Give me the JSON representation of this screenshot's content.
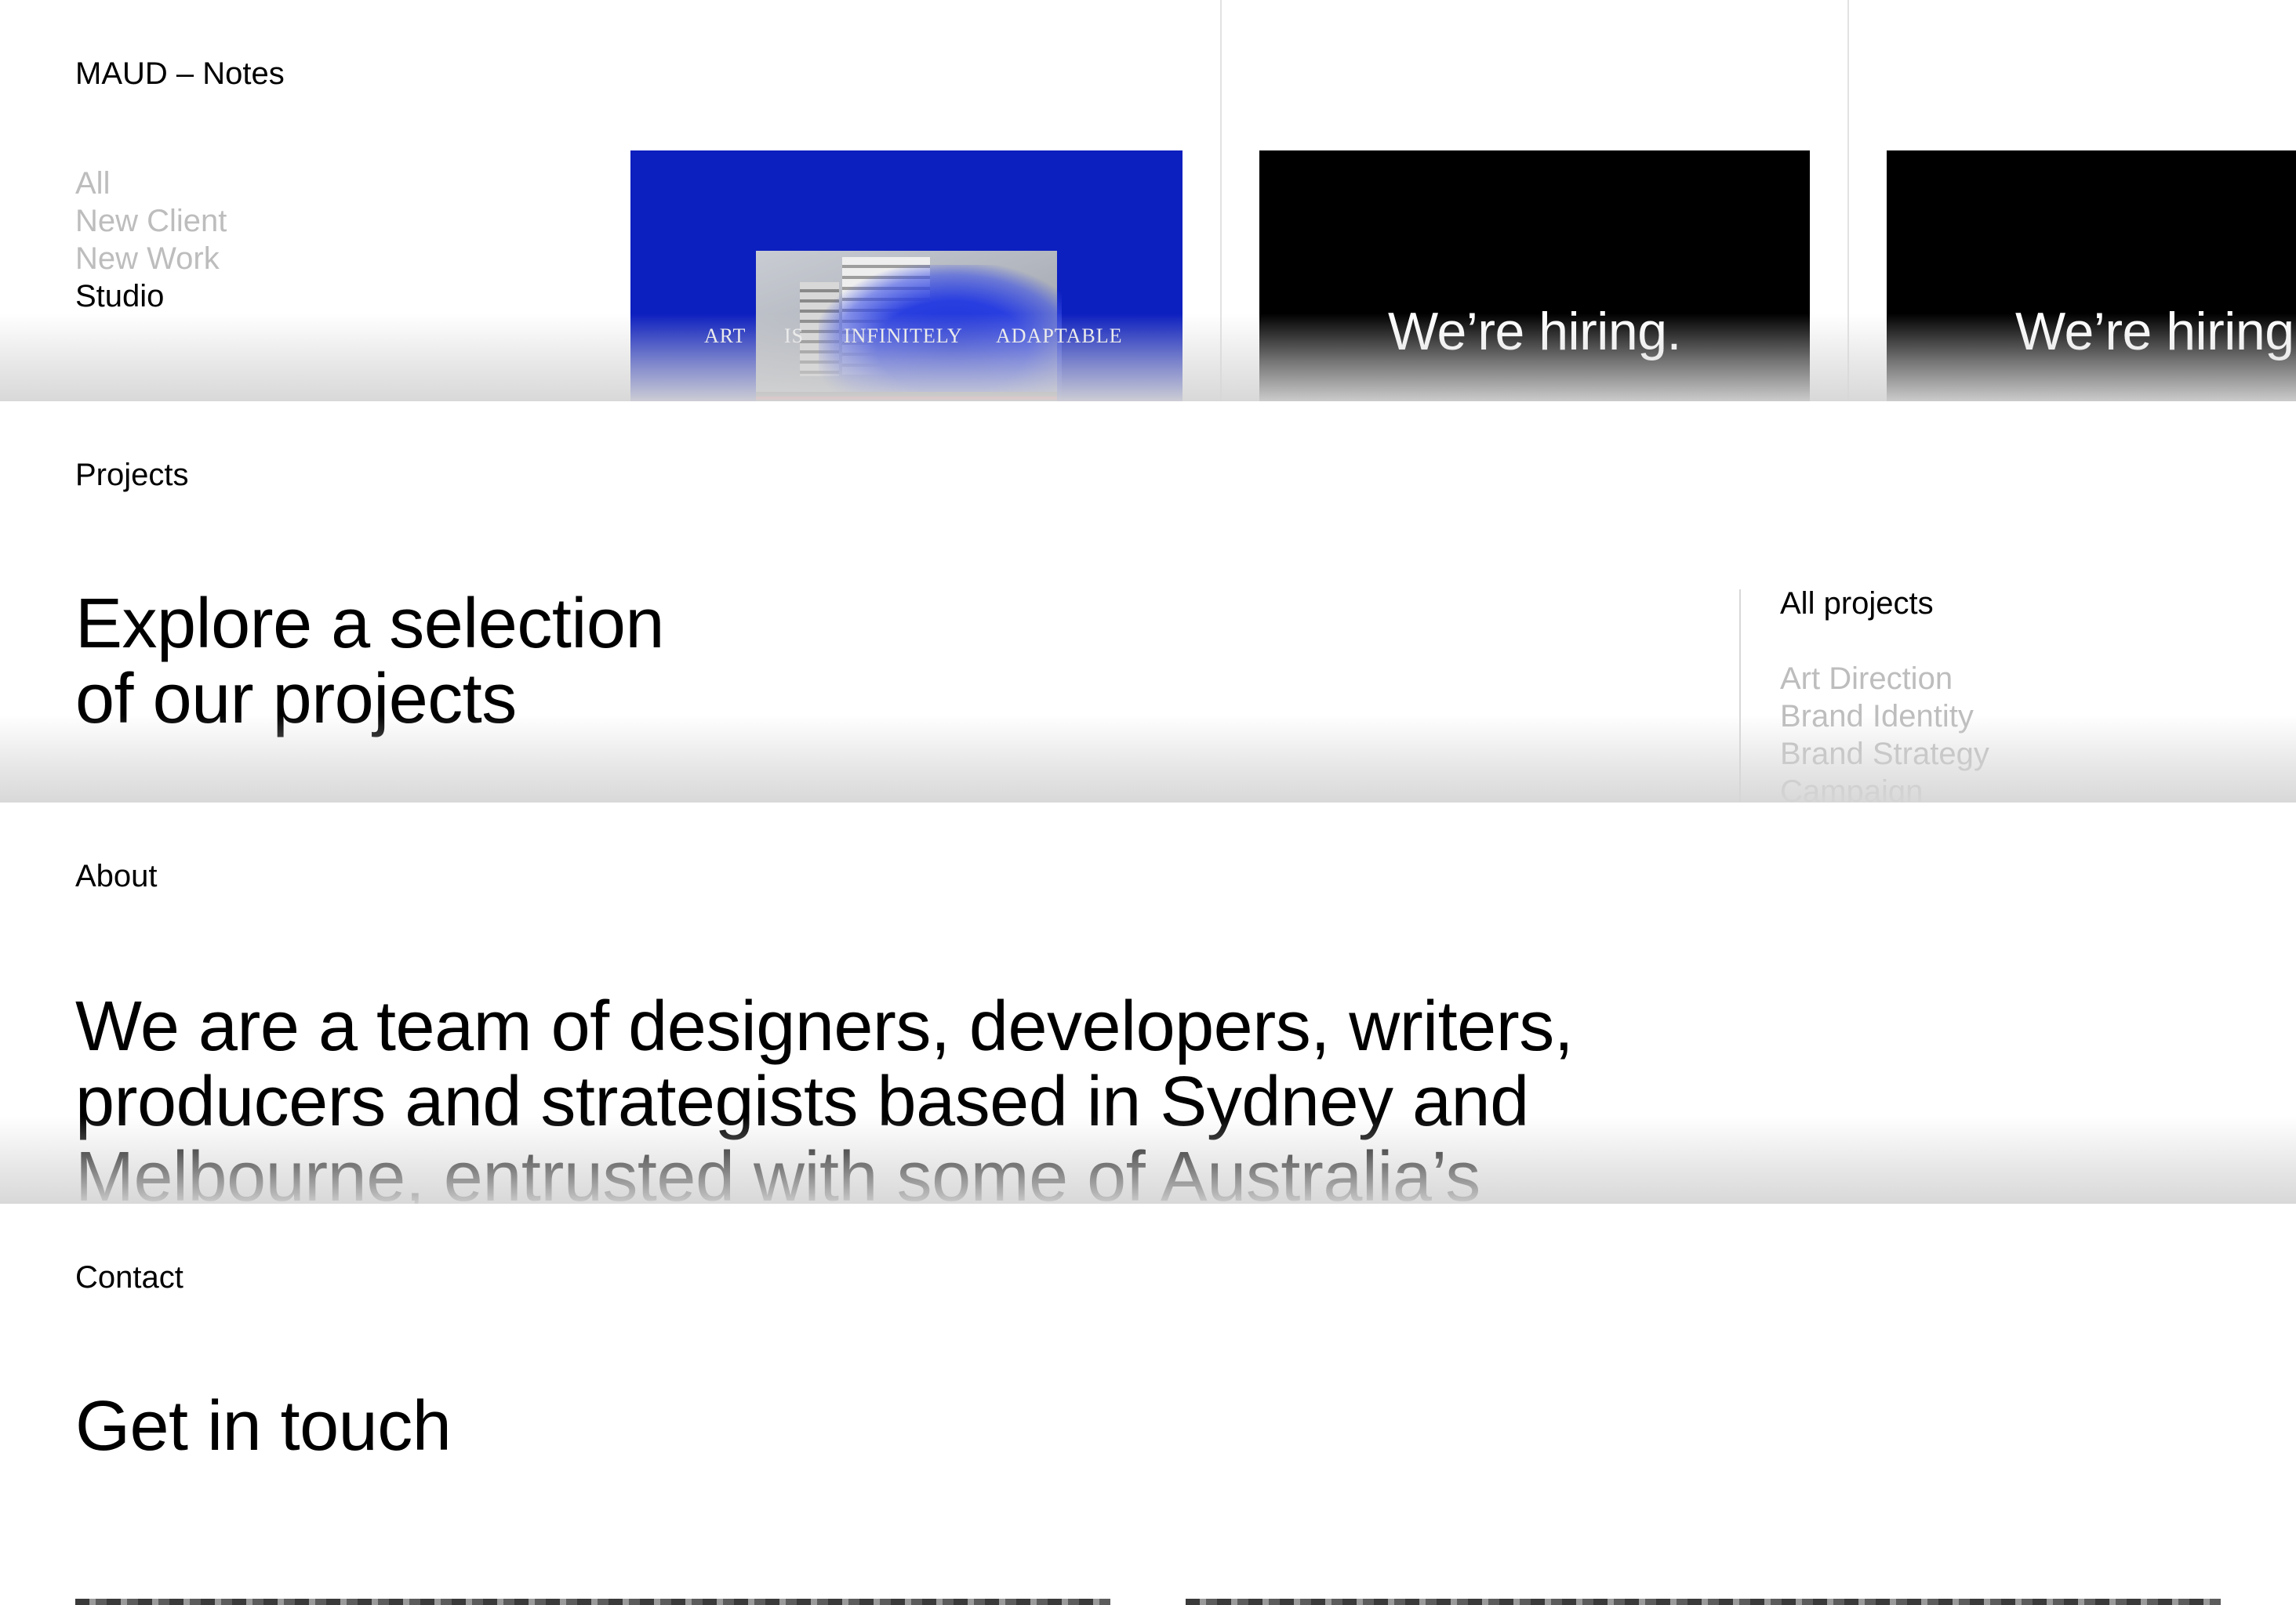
{
  "notes": {
    "title": "MAUD – Notes",
    "filters": [
      "All",
      "New Client",
      "New Work",
      "Studio"
    ],
    "active_filter": "Studio",
    "cards": [
      {
        "type": "image",
        "caption_words": [
          "ART",
          "IS",
          "INFINITELY",
          "ADAPTABLE"
        ],
        "bg": "#0c1fbf"
      },
      {
        "type": "text",
        "text": "We’re hiring.",
        "bg": "#000000"
      },
      {
        "type": "text",
        "text": "We’re hiring",
        "bg": "#000000"
      }
    ]
  },
  "projects": {
    "label": "Projects",
    "heading_line1": "Explore a selection",
    "heading_line2": "of our projects",
    "all_label": "All projects",
    "categories": [
      "Art Direction",
      "Brand Identity",
      "Brand Strategy",
      "Campaign"
    ]
  },
  "about": {
    "label": "About",
    "line1": "We are a team of designers, developers, writers,",
    "line2": "producers and strategists based in Sydney and",
    "line3": "Melbourne, entrusted with some of Australia’s"
  },
  "contact": {
    "label": "Contact",
    "heading": "Get in touch"
  },
  "colors": {
    "inactive_text": "#bdbdbd",
    "accent_blue": "#0c1fbf"
  }
}
